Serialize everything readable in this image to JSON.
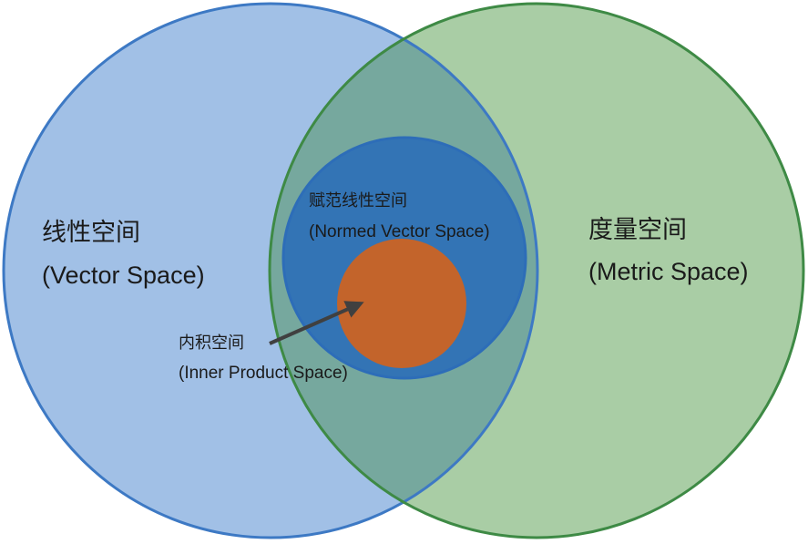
{
  "colors": {
    "vector_fill": "#a1c0e6",
    "vector_stroke": "#3d79c4",
    "metric_fill": "#a9cda5",
    "metric_stroke": "#3e8a45",
    "overlap_fill": "#76a89e",
    "normed_fill": "#3374b5",
    "normed_stroke": "#2d6db8",
    "inner_fill": "#c3642b",
    "arrow": "#404040"
  },
  "sets": {
    "vector_space": {
      "label_cn": "线性空间",
      "label_en": "(Vector Space)"
    },
    "metric_space": {
      "label_cn": "度量空间",
      "label_en": "(Metric Space)"
    },
    "normed_vector_space": {
      "label_cn": "赋范线性空间",
      "label_en": "(Normed Vector Space)"
    },
    "inner_product_space": {
      "label_cn": "内积空间",
      "label_en": "(Inner Product Space)"
    }
  }
}
